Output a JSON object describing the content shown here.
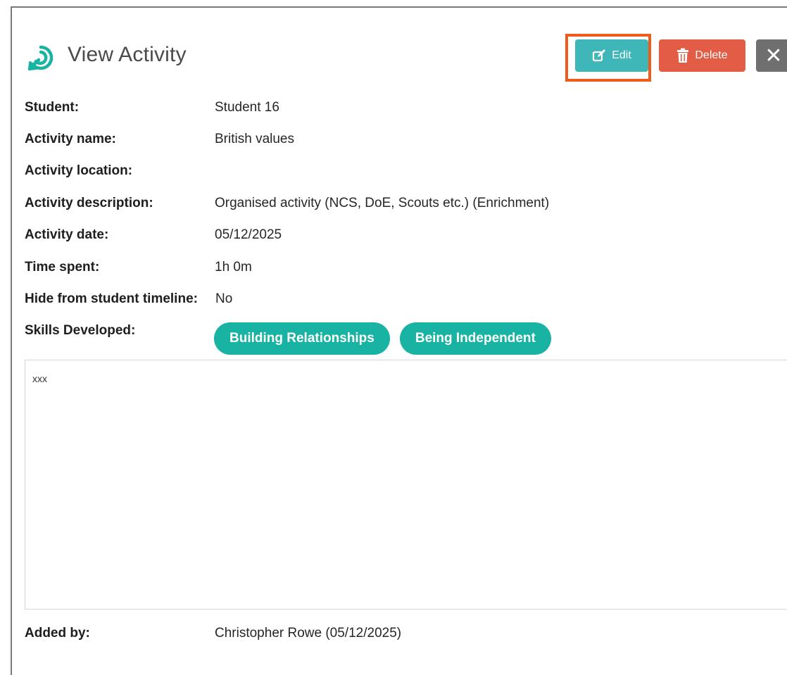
{
  "header": {
    "title": "View Activity",
    "logo_icon": "swirl-arrow-icon",
    "edit_label": "Edit",
    "edit_icon": "edit-pencil-icon",
    "delete_label": "Delete",
    "delete_icon": "trash-icon",
    "close_glyph": "✕",
    "close_icon": "close-icon",
    "colors": {
      "logo": "#17b3a3",
      "edit": "#3fb6b8",
      "delete": "#e35c46",
      "close": "#6f6f6f",
      "highlight": "#f05a1a",
      "chip": "#18b3a3"
    }
  },
  "details": {
    "student": {
      "label": "Student:",
      "value": "Student 16"
    },
    "activity_name": {
      "label": "Activity name:",
      "value": "British values"
    },
    "activity_location": {
      "label": "Activity location:",
      "value": ""
    },
    "activity_description": {
      "label": "Activity description:",
      "value": "Organised activity (NCS, DoE, Scouts etc.) (Enrichment)"
    },
    "activity_date": {
      "label": "Activity date:",
      "value": "05/12/2025"
    },
    "time_spent": {
      "label": "Time spent:",
      "value": "1h 0m"
    },
    "hide_timeline": {
      "label": "Hide from student timeline:",
      "value": "No"
    },
    "skills": {
      "label": "Skills Developed:",
      "items": [
        "Building Relationships",
        "Being Independent"
      ]
    }
  },
  "notes": {
    "text": "xxx"
  },
  "footer": {
    "added_by_label": "Added by:",
    "added_by_value": "Christopher Rowe (05/12/2025)"
  }
}
